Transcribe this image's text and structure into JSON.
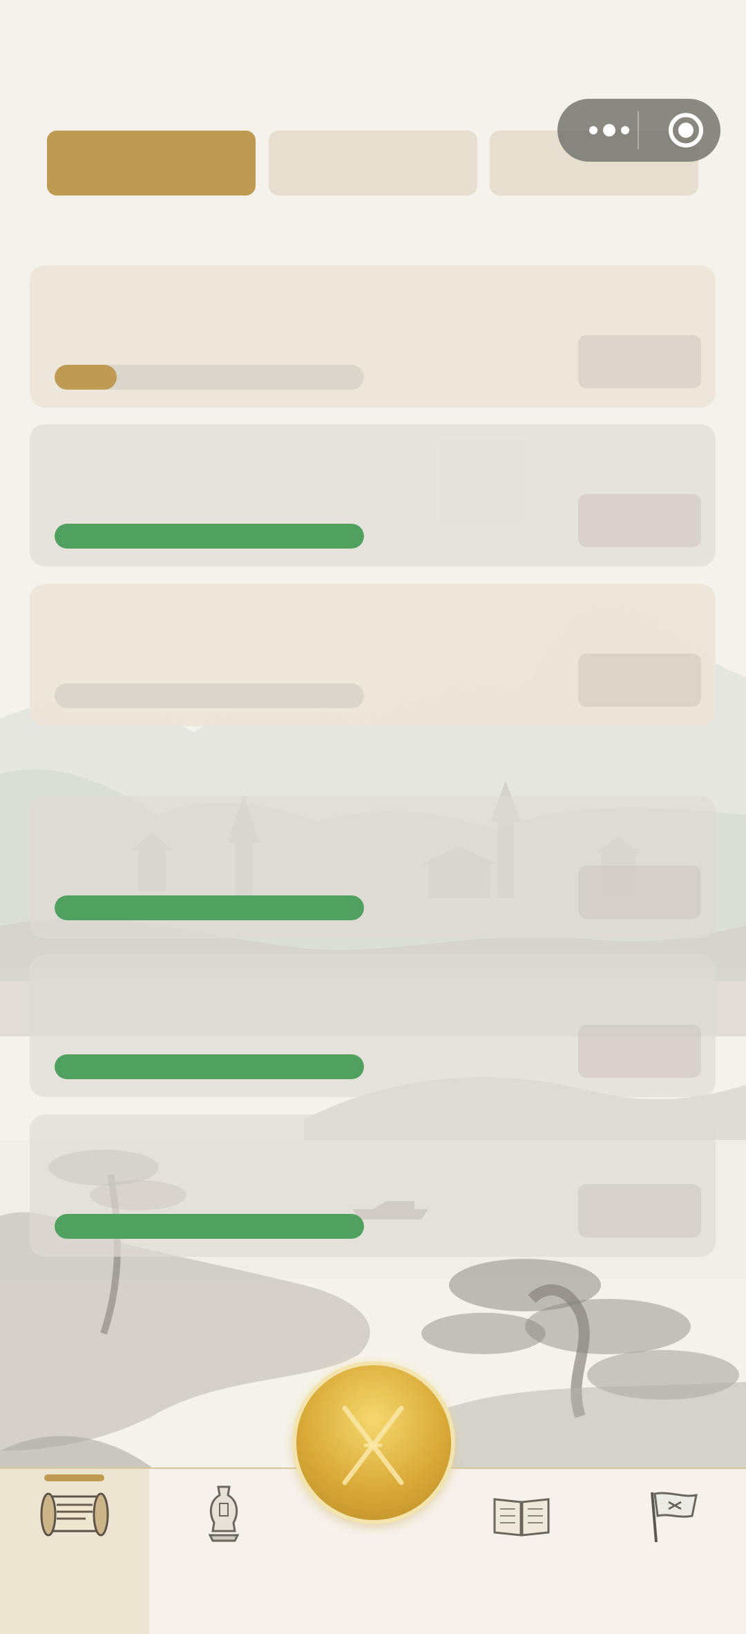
{
  "header": {
    "tabs": [
      {
        "label": "",
        "active": true
      },
      {
        "label": "",
        "active": false
      },
      {
        "label": "",
        "active": false
      }
    ]
  },
  "capsule": {
    "more_icon": "more-dots-icon",
    "close_icon": "target-circle-icon"
  },
  "tasks": [
    {
      "title": "",
      "desc": "",
      "progress": 0.2,
      "bar_color": "#be9a53",
      "action": ""
    },
    {
      "title": "",
      "desc": "",
      "progress": 1.0,
      "bar_color": "#50a060",
      "action": ""
    },
    {
      "title": "",
      "desc": "",
      "progress": 0.0,
      "bar_color": "#be9a53",
      "action": ""
    },
    {
      "title": "",
      "desc": "",
      "progress": 1.0,
      "bar_color": "#50a060",
      "action": ""
    },
    {
      "title": "",
      "desc": "",
      "progress": 1.0,
      "bar_color": "#50a060",
      "action": ""
    },
    {
      "title": "",
      "desc": "",
      "progress": 1.0,
      "bar_color": "#50a060",
      "action": ""
    }
  ],
  "nav": {
    "items": [
      {
        "icon": "scroll-icon",
        "label": "",
        "active": true
      },
      {
        "icon": "vase-icon",
        "label": "",
        "active": false
      },
      {
        "icon": "book-icon",
        "label": "",
        "active": false
      },
      {
        "icon": "flag-icon",
        "label": "",
        "active": false
      }
    ],
    "center": {
      "icon": "crossed-swords-icon"
    }
  },
  "colors": {
    "accent_gold": "#be9a53",
    "success_green": "#50a060",
    "background": "#f5f2ec"
  }
}
